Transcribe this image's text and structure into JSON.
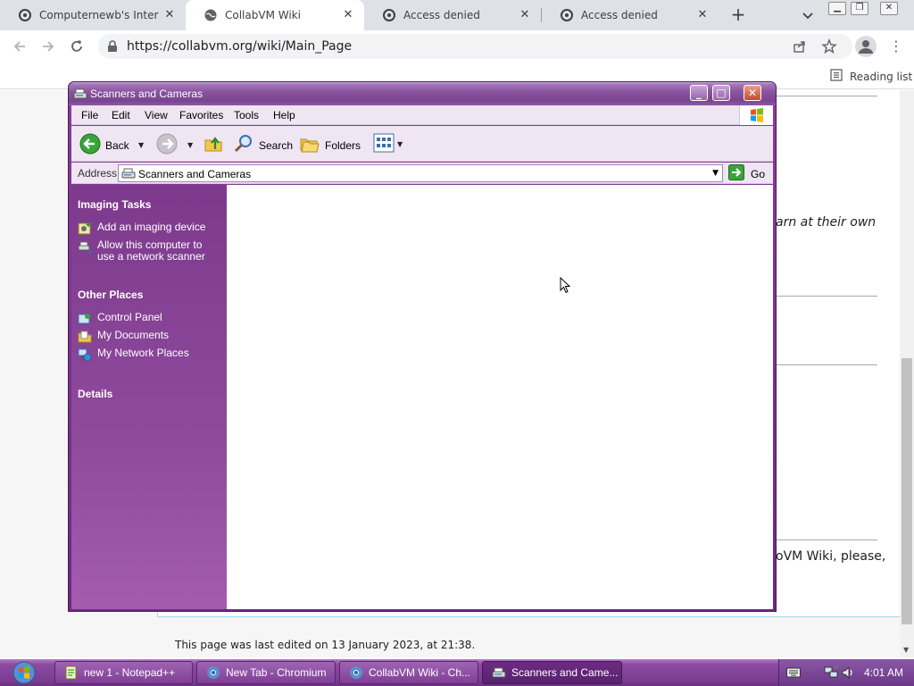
{
  "browser": {
    "tabs": [
      {
        "title": "Computernewb's Internet P",
        "active": false
      },
      {
        "title": "CollabVM Wiki",
        "active": true
      },
      {
        "title": "Access denied",
        "active": false
      },
      {
        "title": "Access denied",
        "active": false
      }
    ],
    "url": "https://collabvm.org/wiki/Main_Page",
    "reading_list_label": "Reading list"
  },
  "webpage": {
    "snippet_1": "arn at their own",
    "snippet_2": "oVM Wiki, please,",
    "footer": "This page was last edited on 13 January 2023, at 21:38."
  },
  "explorer": {
    "title": "Scanners and Cameras",
    "menu": [
      "File",
      "Edit",
      "View",
      "Favorites",
      "Tools",
      "Help"
    ],
    "toolbar": {
      "back": "Back",
      "search": "Search",
      "folders": "Folders"
    },
    "address": {
      "label": "Address",
      "value": "Scanners and Cameras",
      "go": "Go"
    },
    "taskpane": {
      "imaging_title": "Imaging Tasks",
      "imaging_links": [
        "Add an imaging device",
        "Allow this computer to use a network scanner"
      ],
      "other_title": "Other Places",
      "other_links": [
        "Control Panel",
        "My Documents",
        "My Network Places"
      ],
      "details_title": "Details"
    }
  },
  "taskbar": {
    "items": [
      {
        "label": "new 1 - Notepad++",
        "icon": "notepad-icon"
      },
      {
        "label": "New Tab - Chromium",
        "icon": "chromium-icon"
      },
      {
        "label": "CollabVM Wiki - Ch...",
        "icon": "chromium-icon"
      },
      {
        "label": "Scanners and Came...",
        "icon": "scanner-icon",
        "active": true
      }
    ],
    "clock": "4:01 AM"
  },
  "colors": {
    "xp_purple": "#7a4492",
    "taskpane": "#8f4a9c",
    "chrome_tabstrip": "#dee1e6"
  }
}
